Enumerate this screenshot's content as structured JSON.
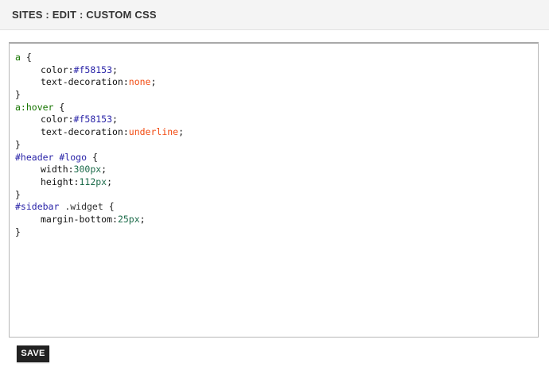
{
  "header": {
    "title": "SITES : EDIT : CUSTOM CSS"
  },
  "editor": {
    "lines": [
      {
        "sel": "a",
        "sel_kind": "element",
        "open": " {"
      },
      {
        "prop": "color:",
        "val": "#f58153",
        "val_kind": "hex",
        "end": ";"
      },
      {
        "prop": "text-decoration:",
        "val": "none",
        "val_kind": "keyword",
        "end": ";"
      },
      {
        "close": "}"
      },
      {
        "sel": "a:hover",
        "sel_kind": "element",
        "open": " {"
      },
      {
        "prop": "color:",
        "val": "#f58153",
        "val_kind": "hex",
        "end": ";"
      },
      {
        "prop": "text-decoration:",
        "val": "underline",
        "val_kind": "keyword",
        "end": ";"
      },
      {
        "close": "}"
      },
      {
        "sel": "#header #logo",
        "sel_kind": "id",
        "open": " {"
      },
      {
        "prop": "width:",
        "val": "300px",
        "val_kind": "number",
        "end": ";"
      },
      {
        "prop": "height:",
        "val": "112px",
        "val_kind": "number",
        "end": ";"
      },
      {
        "close": "}"
      },
      {
        "sel": "#sidebar",
        "sel_kind": "id",
        "sel2": " .widget",
        "open": " {"
      },
      {
        "prop": "margin-bottom:",
        "val": "25px",
        "val_kind": "number",
        "end": ";"
      },
      {
        "close": "}"
      }
    ]
  },
  "save_button": {
    "label": "SAVE"
  },
  "colors": {
    "header_bg": "#f4f4f4",
    "button_bg": "#222222",
    "selector_element": "#177500",
    "selector_id": "#2a24a8",
    "value_keyword": "#f24a10",
    "value_number": "#1c6b4a"
  }
}
